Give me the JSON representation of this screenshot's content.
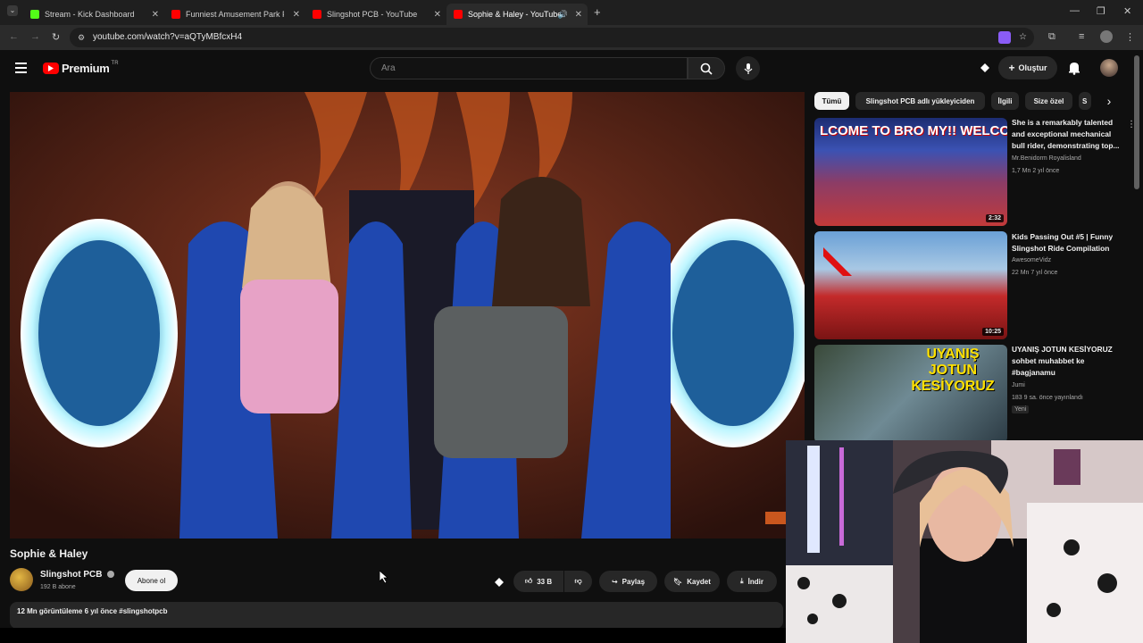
{
  "browser": {
    "tabs": [
      {
        "title": "Stream - Kick Dashboard",
        "favicon_color": "#53fc18"
      },
      {
        "title": "Funniest Amusement Park Fails",
        "favicon_color": "#ff0000"
      },
      {
        "title": "Slingshot PCB - YouTube",
        "favicon_color": "#ff0000"
      },
      {
        "title": "Sophie & Haley - YouTube",
        "favicon_color": "#ff0000"
      }
    ],
    "url": "youtube.com/watch?v=aQTyMBfcxH4"
  },
  "youtube": {
    "logo_text": "Premium",
    "logo_region": "TR",
    "search_placeholder": "Ara",
    "create_label": "Oluştur",
    "brand_color": "#ff0000"
  },
  "video": {
    "title": "Sophie & Haley",
    "channel": "Slingshot PCB",
    "subscribers": "192 B abone",
    "subscribe_label": "Abone ol",
    "likes": "33 B",
    "share_label": "Paylaş",
    "save_label": "Kaydet",
    "download_label": "İndir",
    "meta_text": "12 Mn görüntüleme  6 yıl önce  #slingshotpcb"
  },
  "chips": [
    "Tümü",
    "Slingshot PCB adlı yükleyiciden",
    "İlgili",
    "Size özel",
    "S"
  ],
  "recommendations": [
    {
      "title_lines": [
        "She is a remarkably talented",
        "and exceptional mechanical",
        "bull rider, demonstrating top..."
      ],
      "channel": "Mr.Benidorm Royalisland",
      "meta": "1,7 Mn  2 yıl önce",
      "duration": "2:32",
      "thumb_text": "LCOME TO BRO  MY!! WELCO"
    },
    {
      "title_lines": [
        "Kids Passing Out #5 | Funny",
        "Slingshot Ride Compilation"
      ],
      "channel": "AwesomeVidz",
      "meta": "22 Mn  7 yıl önce",
      "duration": "10:25",
      "thumb_text": ""
    },
    {
      "title_lines": [
        "UYANIŞ JOTUN KESİYORUZ",
        "sohbet muhabbet ke",
        "#bagjanamu"
      ],
      "channel": "Jumi",
      "meta": "183  9 sa. önce yayınlandı",
      "badge": "Yeni",
      "duration": "",
      "thumb_text": "UYANIŞ JOTUN KESİYORUZ"
    }
  ]
}
